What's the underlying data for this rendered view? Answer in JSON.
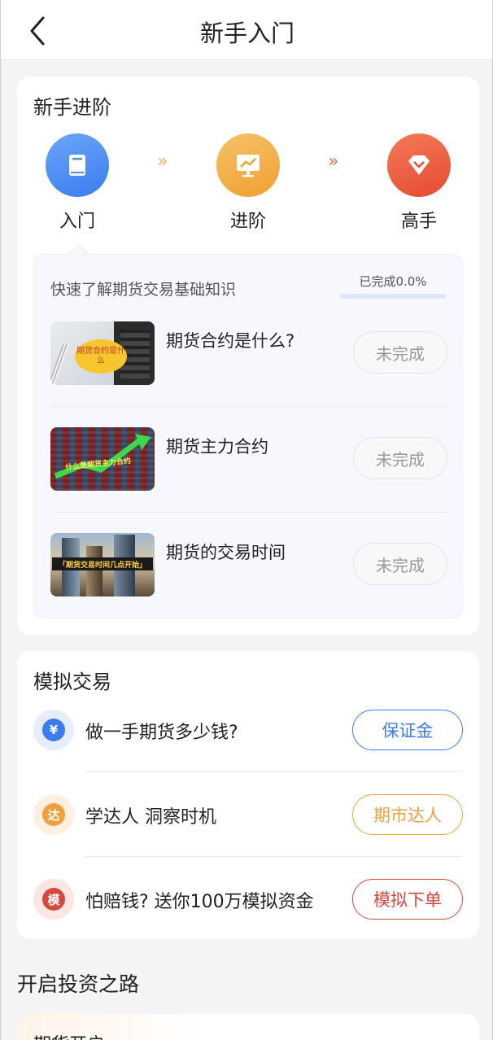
{
  "header": {
    "title": "新手入门",
    "back_icon": "chevron-left-icon"
  },
  "advance": {
    "title": "新手进阶",
    "steps": [
      {
        "label": "入门",
        "icon": "book-icon",
        "color": "#4f8ff2"
      },
      {
        "label": "进阶",
        "icon": "chart-board-icon",
        "color": "#f2a93b"
      },
      {
        "label": "高手",
        "icon": "diamond-icon",
        "color": "#ee5a3c"
      }
    ],
    "panel": {
      "heading": "快速了解期货交易基础知识",
      "progress_text": "已完成0.0%",
      "progress": 0.0,
      "lessons": [
        {
          "title": "期货合约是什么?",
          "thumb_text": "期货合约是什么",
          "status": "未完成"
        },
        {
          "title": "期货主力合约",
          "thumb_text": "什么是期货主力合约",
          "status": "未完成"
        },
        {
          "title": "期货的交易时间",
          "thumb_text": "「期货交易时间几点开始」",
          "status": "未完成"
        }
      ]
    }
  },
  "simulate": {
    "title": "模拟交易",
    "rows": [
      {
        "icon_char": "¥",
        "text": "做一手期货多少钱?",
        "button": "保证金",
        "color": "#3b7cf5",
        "ring": "#e6eefc"
      },
      {
        "icon_char": "达",
        "text": "学达人 洞察时机",
        "button": "期市达人",
        "color": "#f2a03b",
        "ring": "#fdf0e0"
      },
      {
        "icon_char": "模",
        "text": "怕赔钱? 送你100万模拟资金",
        "button": "模拟下单",
        "color": "#d9473a",
        "ring": "#fbe6e3"
      }
    ]
  },
  "invest": {
    "title": "开启投资之路",
    "card_title": "期货开户"
  }
}
